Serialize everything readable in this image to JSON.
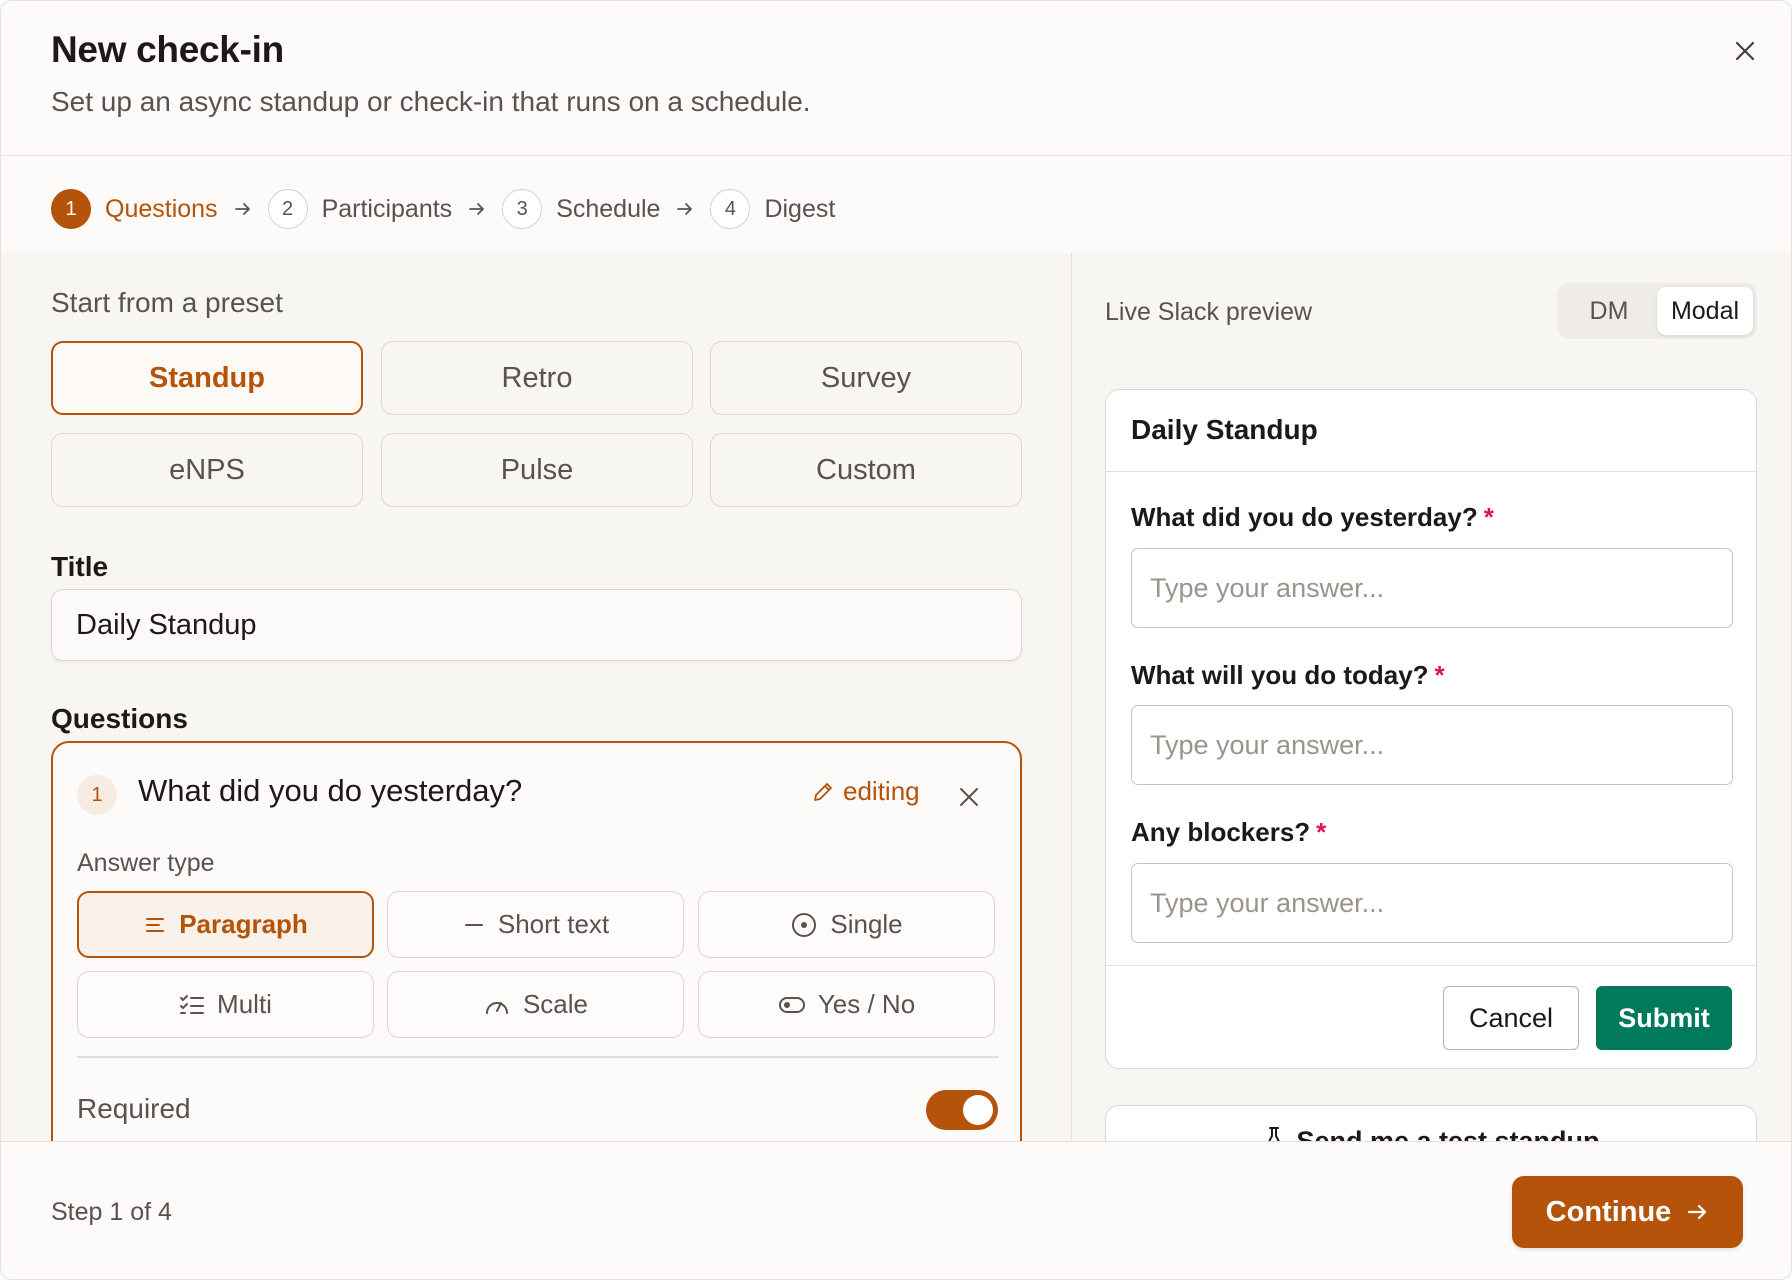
{
  "header": {
    "title": "New check-in",
    "subtitle": "Set up an async standup or check-in that runs on a schedule."
  },
  "stepper": [
    {
      "num": "1",
      "label": "Questions",
      "active": true
    },
    {
      "num": "2",
      "label": "Participants",
      "active": false
    },
    {
      "num": "3",
      "label": "Schedule",
      "active": false
    },
    {
      "num": "4",
      "label": "Digest",
      "active": false
    }
  ],
  "presets": {
    "label": "Start from a preset",
    "items": [
      "Standup",
      "Retro",
      "Survey",
      "eNPS",
      "Pulse",
      "Custom"
    ],
    "selected": "Standup"
  },
  "title_field": {
    "label": "Title",
    "value": "Daily Standup"
  },
  "questions": {
    "label": "Questions",
    "current": {
      "number": "1",
      "text": "What did you do yesterday?",
      "editing_label": "editing",
      "answer_type_label": "Answer type",
      "answer_types": [
        {
          "label": "Paragraph",
          "icon": "paragraph-icon"
        },
        {
          "label": "Short text",
          "icon": "short-text-icon"
        },
        {
          "label": "Single",
          "icon": "radio-icon"
        },
        {
          "label": "Multi",
          "icon": "checklist-icon"
        },
        {
          "label": "Scale",
          "icon": "gauge-icon"
        },
        {
          "label": "Yes / No",
          "icon": "toggle-icon"
        }
      ],
      "selected_answer_type": "Paragraph",
      "required_label": "Required",
      "required": true
    }
  },
  "preview": {
    "label": "Live Slack preview",
    "modes": [
      "DM",
      "Modal"
    ],
    "selected_mode": "Modal",
    "modal": {
      "title": "Daily Standup",
      "questions": [
        {
          "label": "What did you do yesterday?",
          "required_mark": "*",
          "placeholder": "Type your answer..."
        },
        {
          "label": "What will you do today?",
          "required_mark": "*",
          "placeholder": "Type your answer..."
        },
        {
          "label": "Any blockers?",
          "required_mark": "*",
          "placeholder": "Type your answer..."
        }
      ],
      "cancel_label": "Cancel",
      "submit_label": "Submit"
    },
    "test_button_label": "Send me a test standup"
  },
  "footer": {
    "step_text": "Step 1 of 4",
    "continue_label": "Continue"
  },
  "colors": {
    "accent": "#b45309",
    "slack_green": "#007a5a",
    "required_star": "#e0115f"
  }
}
